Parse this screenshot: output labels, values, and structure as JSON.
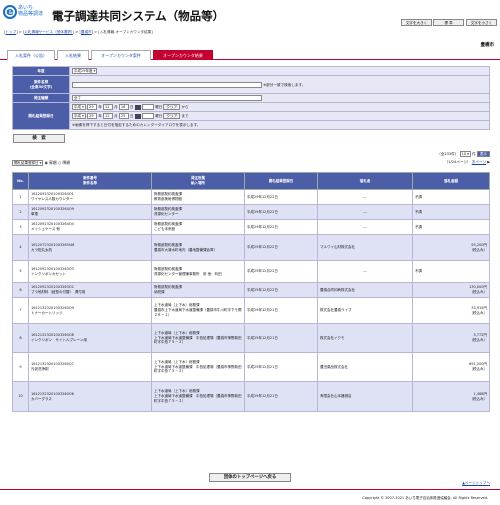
{
  "header": {
    "logo_line1": "あいち",
    "logo_line2": "物品等調達",
    "title": "電子調達共同システム（物品等）",
    "btn_large": "文字を大きく",
    "btn_standard": "標 準",
    "btn_small": "文字を小さく"
  },
  "breadcrumb": {
    "top": "トップ",
    "service": "入札情報サービス（団体選択）",
    "org": "豊橋市",
    "current": "入札情報-オープンカウンタ結果"
  },
  "tabs": [
    "入札案件（公告）",
    "入札結果",
    "オープンカウンタ案件",
    "オープンカウンタ結果"
  ],
  "org_name": "豊橋市",
  "form": {
    "year_label": "年度",
    "year_value": "平成29年度",
    "case_label": "案件名称\n(全角30文字)",
    "case_note": "※部分一致で検索します。",
    "type_label": "発注種類",
    "type_value": "全て",
    "date_label": "開札結果登録日",
    "era": "平成",
    "from_year": "29",
    "from_month": "12",
    "from_day": "16",
    "to_year": "29",
    "to_month": "12",
    "to_day": "25",
    "year_unit": "年",
    "month_unit": "月",
    "day_unit": "日",
    "day_from": "曜日",
    "clear": "クリア",
    "from": "から",
    "to": "まで",
    "weekday_hint": "曜日",
    "cal_note": "※画像を押下すると日付を指定するためのカレンダーダイアログを表示します。",
    "search": "検　索"
  },
  "sort": {
    "value": "開札結果登録日",
    "asc": "昇順",
    "desc": "降順"
  },
  "paging": {
    "total": "（全233件）",
    "per_page": "10",
    "per_unit": "件",
    "show": "表示",
    "page_info": "（1/24ページ）",
    "next": "次ページ"
  },
  "table": {
    "headers": [
      "No.",
      "案件番号\n案件名称",
      "発注所属\n納入場所",
      "開札結果登録日",
      "落札者",
      "落札金額"
    ],
    "rows": [
      {
        "no": "1",
        "case_no": "16120923201003264O1",
        "case_name": "ワイヤレス人数カウンター",
        "dept": "財務部契約検査課",
        "place": "教育部美術博物館",
        "date": "平成29年12月22日",
        "winner": "---",
        "amount": "不調",
        "note": ""
      },
      {
        "no": "2",
        "case_no": "16120923201003264O9",
        "case_name": "単根",
        "dept": "財務部契約検査課",
        "place": "資源化センター",
        "date": "平成29年12月22日",
        "winner": "---",
        "amount": "不調",
        "note": ""
      },
      {
        "no": "3",
        "case_no": "16120923201003264O4",
        "case_name": "メッシュケース 他",
        "dept": "財務部契約検査課",
        "place": "こども未来館",
        "date": "平成29年12月22日",
        "winner": "---",
        "amount": "不調",
        "note": ""
      },
      {
        "no": "4",
        "case_no": "16120723201003265I46",
        "case_name": "カラ松丸太杭",
        "dept": "財務部契約検査課",
        "place": "豊橋市大清水町地内（農地整備課倉庫）",
        "date": "平成29年12月22日",
        "winner": "マルワイ山材株式会社",
        "amount": "55,200円",
        "note": "（税込み）"
      },
      {
        "no": "5",
        "case_no": "16120923201003263O3",
        "case_name": "インクリボンカセット",
        "dept": "財務部契約検査課",
        "place": "資源化センター管理棟事務所　前 他：利田",
        "date": "平成29年12月22日",
        "winner": "---",
        "amount": "不調",
        "note": ""
      },
      {
        "no": "6",
        "case_no": "16120923201003263O2",
        "case_name": "プラ他材料（紐型の付替）　湧付用",
        "dept": "財務部契約検査課",
        "place": "納税課",
        "date": "平成29年12月22日",
        "winner": "豊橋合同印刷株式会社",
        "amount": "130,000円",
        "note": "（税込み）"
      },
      {
        "no": "7",
        "case_no": "16121323201003260O9",
        "case_name": "トナーカートリッジ",
        "dept": "上下水道局（上下水）総務課",
        "place": "豊橋市上下水道局下水道整備課（豊橋市牛川町字下モ郷２８－１）",
        "date": "平成29年12月21日",
        "winner": "株式会社豊橋ライブ",
        "amount": "33,915円",
        "note": "（税込み）"
      },
      {
        "no": "8",
        "case_no": "16121323201003260O8",
        "case_name": "インクリボン　サイトルプレーン用",
        "dept": "上下水道局（上下水）総務課",
        "place": "上下水道局下水道整備課　中島処理場（豊橋市神野新田町字中島７５－２）",
        "date": "平成29年12月21日",
        "winner": "株式会社イクモ",
        "amount": "5,772円",
        "note": "（税込み）"
      },
      {
        "no": "9",
        "case_no": "16121323201003260O7",
        "case_name": "汚泥洗浄剤",
        "dept": "上下水道局（上下水）総務課",
        "place": "上下水道局下水道整備課　中島処理場（豊橋市神野新田町字中島７５－２）",
        "date": "平成29年12月21日",
        "winner": "豊田薬品株式会社",
        "amount": "691,200円",
        "note": "（税込み）"
      },
      {
        "no": "10",
        "case_no": "16121323201003260O6",
        "case_name": "カバーグラス",
        "dept": "上下水道局（上下水）総務課",
        "place": "上下水道局下水道整備課　中島処理場（豊橋市神野新田町字中島７５－２）",
        "date": "平成29年12月21日",
        "winner": "有限会社山本器械店",
        "amount": "1,468円",
        "note": "（税込み）"
      }
    ]
  },
  "footer": {
    "top_button": "団体のトップページへ戻る",
    "page_top": "▲ページトップへ",
    "copyright": "Copyright © 2007-2021 あいち電子自治体推進協議会. All Rights Reserved."
  }
}
